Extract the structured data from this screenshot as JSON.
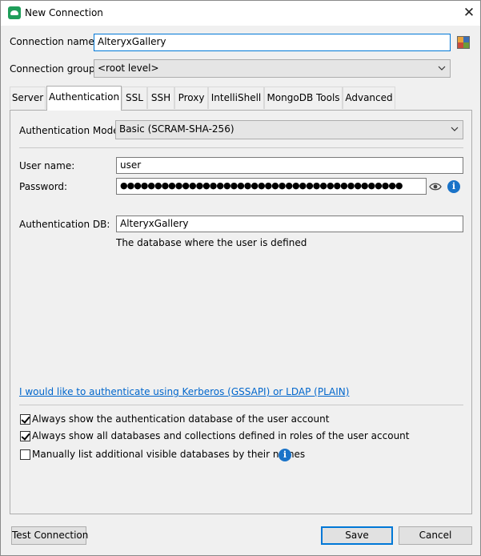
{
  "window": {
    "title": "New Connection",
    "close_glyph": "✕"
  },
  "connection": {
    "name_label": "Connection name:",
    "name_value": "AlteryxGallery",
    "group_label": "Connection group:",
    "group_value": "<root level>"
  },
  "tabs": [
    {
      "label": "Server"
    },
    {
      "label": "Authentication",
      "active": true
    },
    {
      "label": "SSL"
    },
    {
      "label": "SSH"
    },
    {
      "label": "Proxy"
    },
    {
      "label": "IntelliShell"
    },
    {
      "label": "MongoDB Tools"
    },
    {
      "label": "Advanced"
    }
  ],
  "auth": {
    "mode_label": "Authentication Mode:",
    "mode_value": "Basic (SCRAM-SHA-256)",
    "username_label": "User name:",
    "username_value": "user",
    "password_label": "Password:",
    "password_mask": "●●●●●●●●●●●●●●●●●●●●●●●●●●●●●●●●●●●●●●●●●",
    "authdb_label": "Authentication DB:",
    "authdb_value": "AlteryxGallery",
    "authdb_hint": "The database where the user is defined",
    "kerberos_link": "I would like to authenticate using Kerberos (GSSAPI) or LDAP (PLAIN)"
  },
  "options": [
    {
      "label": "Always show the authentication database of the user account",
      "checked": true
    },
    {
      "label": "Always show all databases and collections defined in roles of the user account",
      "checked": true
    },
    {
      "label": "Manually list additional visible databases by their names",
      "checked": false
    }
  ],
  "info_glyph": "i",
  "buttons": {
    "test": "Test Connection",
    "save": "Save",
    "cancel": "Cancel"
  },
  "colors": {
    "accent": "#0078d7",
    "info": "#1a73c8",
    "link": "#0066cc",
    "app_icon": "#1f9e5a"
  },
  "icons": {
    "app": "studio3t-app-icon",
    "close": "close-icon",
    "color_picker": "color-picker-icon",
    "dropdown": "chevron-down-icon",
    "show_password": "eye-icon",
    "info": "info-icon"
  }
}
